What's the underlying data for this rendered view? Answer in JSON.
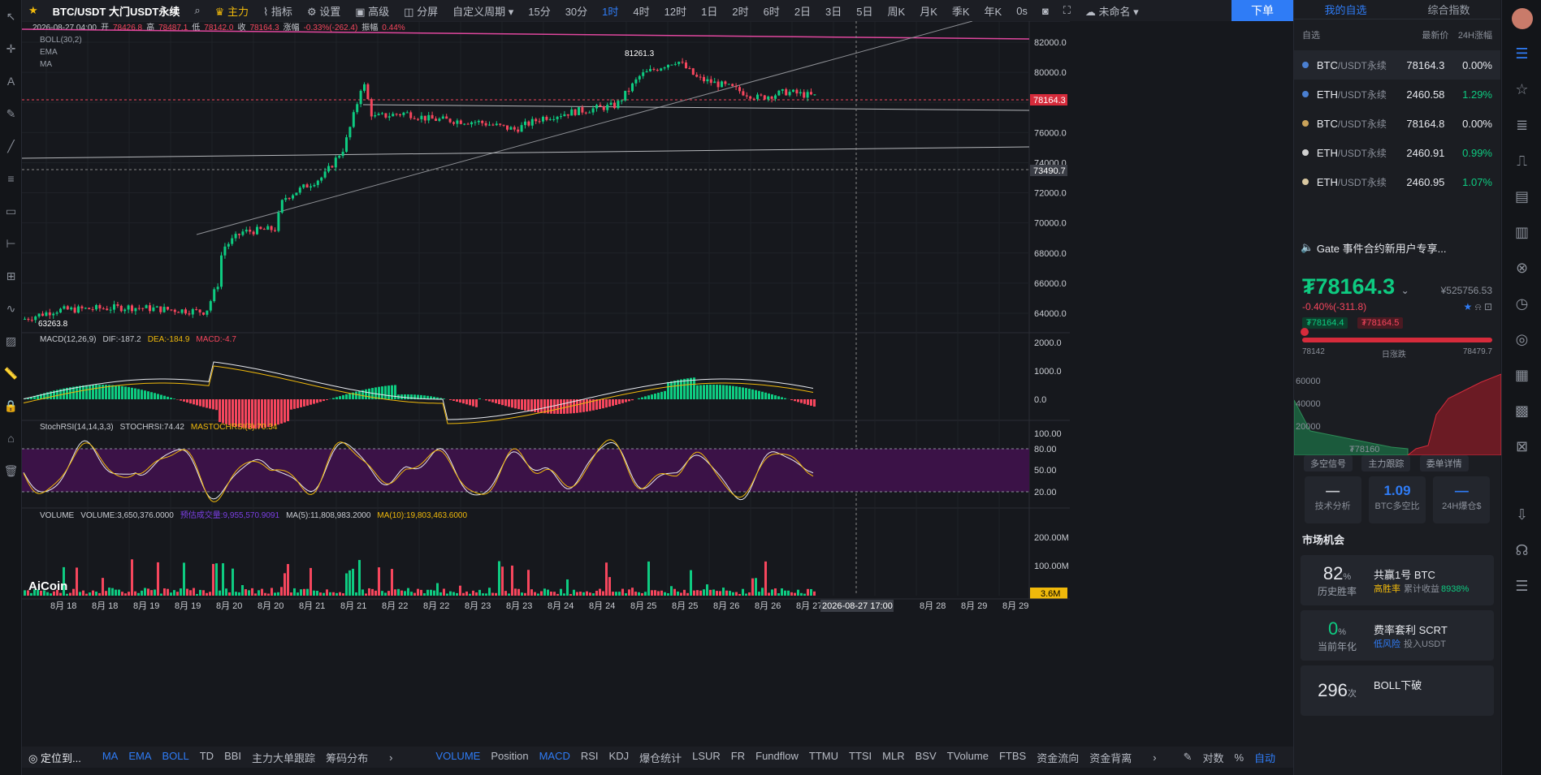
{
  "title": "BTC/USDT 大门USDT永续",
  "toolbar": {
    "main_force": "主力",
    "indicators": "指标",
    "settings": "设置",
    "advanced": "高级",
    "split": "分屏",
    "custom_period": "自定义周期",
    "order_button": "下单",
    "unnamed": "未命名",
    "countdown": "0s",
    "periods": [
      {
        "label": "15分",
        "active": false
      },
      {
        "label": "30分",
        "active": false
      },
      {
        "label": "1时",
        "active": true
      },
      {
        "label": "4时",
        "active": false
      },
      {
        "label": "12时",
        "active": false
      },
      {
        "label": "1日",
        "active": false
      },
      {
        "label": "2时",
        "active": false
      },
      {
        "label": "6时",
        "active": false
      },
      {
        "label": "2日",
        "active": false
      },
      {
        "label": "3日",
        "active": false
      },
      {
        "label": "5日",
        "active": false
      },
      {
        "label": "周K",
        "active": false
      },
      {
        "label": "月K",
        "active": false
      },
      {
        "label": "季K",
        "active": false
      },
      {
        "label": "年K",
        "active": false
      }
    ]
  },
  "ohlc": {
    "date": "2026-08-27 04:00",
    "open_label": "开",
    "open": "78426.8",
    "high_label": "高",
    "high": "78487.1",
    "low_label": "低",
    "low": "78142.0",
    "close_label": "收",
    "close": "78164.3",
    "change_label": "涨幅",
    "change": "-0.33%(-262.4)",
    "amp_label": "振幅",
    "amp": "0.44%"
  },
  "overlay_labels": [
    "BOLL(30,2)",
    "EMA",
    "MA"
  ],
  "price_axis": [
    "82000.0",
    "80000.0",
    "78000.0",
    "76000.0",
    "74000.0",
    "72000.0",
    "70000.0",
    "68000.0",
    "66000.0",
    "64000.0"
  ],
  "current_price_tag": "78164.3",
  "crosshair_price_tag": "73490.7",
  "high_marker": "81261.3",
  "low_marker": "63263.8",
  "macd": {
    "label": "MACD(12,26,9)",
    "dif": "DIF:-187.2",
    "dea": "DEA:-184.9",
    "macd": "MACD:-4.7",
    "axis": [
      "2000.0",
      "1000.0",
      "0.0"
    ]
  },
  "stoch": {
    "label": "StochRSI(14,14,3,3)",
    "stoch": "STOCHRSI:74.42",
    "ma": "MASTOCHRSI(3):70.34",
    "axis": [
      "100.00",
      "80.00",
      "50.00",
      "20.00"
    ]
  },
  "volume": {
    "label": "VOLUME",
    "vol": "VOLUME:3,650,376.0000",
    "est": "预估成交量:9,955,570.9091",
    "ma5": "MA(5):11,808,983.2000",
    "ma10": "MA(10):19,803,463.6000",
    "axis": [
      "200.00M",
      "100.00M"
    ],
    "tag": "3.6M"
  },
  "x_axis": [
    "8月 18",
    "8月 18",
    "8月 19",
    "8月 19",
    "8月 20",
    "8月 20",
    "8月 21",
    "8月 21",
    "8月 22",
    "8月 22",
    "8月 23",
    "8月 23",
    "8月 24",
    "8月 24",
    "8月 25",
    "8月 25",
    "8月 26",
    "8月 26",
    "8月 27",
    "2026-08-27 17:00",
    "8月 28",
    "8月 29",
    "8月 29"
  ],
  "logo": "AiCoin",
  "bottom": {
    "locate": "定位到...",
    "left": [
      "MA",
      "EMA",
      "BOLL",
      "TD",
      "BBI",
      "主力大单跟踪",
      "筹码分布"
    ],
    "mid": [
      "VOLUME",
      "Position",
      "MACD",
      "RSI",
      "KDJ",
      "爆仓统计",
      "LSUR",
      "FR",
      "Fundflow",
      "TTMU",
      "TTSI",
      "MLR",
      "BSV",
      "TVolume",
      "FTBS",
      "资金流向",
      "资金背离"
    ],
    "log": "对数",
    "pct": "%",
    "auto": "自动"
  },
  "right": {
    "tab_fav": "我的自选",
    "tab_index": "综合指数",
    "head_fav": "自选",
    "head_price": "最新价",
    "head_chg": "24H涨幅",
    "watch": [
      {
        "base": "BTC",
        "quote": "/USDT永续",
        "price": "78164.3",
        "chg": "0.00%",
        "color": "#4a7fd1"
      },
      {
        "base": "ETH",
        "quote": "/USDT永续",
        "price": "2460.58",
        "chg": "1.29%",
        "color": "#4a7fd1"
      },
      {
        "base": "BTC",
        "quote": "/USDT永续",
        "price": "78164.8",
        "chg": "0.00%",
        "color": "#c9a25a"
      },
      {
        "base": "ETH",
        "quote": "/USDT永续",
        "price": "2460.91",
        "chg": "0.99%",
        "color": "#d0d0d0"
      },
      {
        "base": "ETH",
        "quote": "/USDT永续",
        "price": "2460.95",
        "chg": "1.07%",
        "color": "#d8c7a0"
      }
    ],
    "news": "Gate 事件合约新用户专享...",
    "price": "78164.3",
    "cny": "¥525756.53",
    "delta": "-0.40%(-311.8)",
    "bid": "₮78164.4",
    "ask": "₮78164.5",
    "low": "78142",
    "high": "78479.7",
    "day_label": "日涨跌",
    "depth_axis": [
      "60000",
      "40000",
      "20000"
    ],
    "depth_mid": "₮78160",
    "pills": [
      "多空信号",
      "主力跟踪",
      "委单详情"
    ],
    "stats": [
      {
        "v": "—",
        "l": "技术分析"
      },
      {
        "v": "1.09",
        "l": "BTC多空比"
      },
      {
        "v": "—",
        "l": "24H爆仓$"
      }
    ],
    "market": "市场机会",
    "opps": [
      {
        "big": "82",
        "unit": "%",
        "sub": "历史胜率",
        "title": "共赢1号 BTC",
        "tag": "高胜率",
        "desc": "累计收益",
        "val": "8938%"
      },
      {
        "big": "0",
        "unit": "%",
        "sub": "当前年化",
        "title": "费率套利 SCRT",
        "tag": "低风险",
        "desc": "投入USDT",
        "val": ""
      },
      {
        "big": "296",
        "unit": "次",
        "sub": "",
        "title": "BOLL下破",
        "tag": "",
        "desc": "",
        "val": ""
      }
    ]
  }
}
